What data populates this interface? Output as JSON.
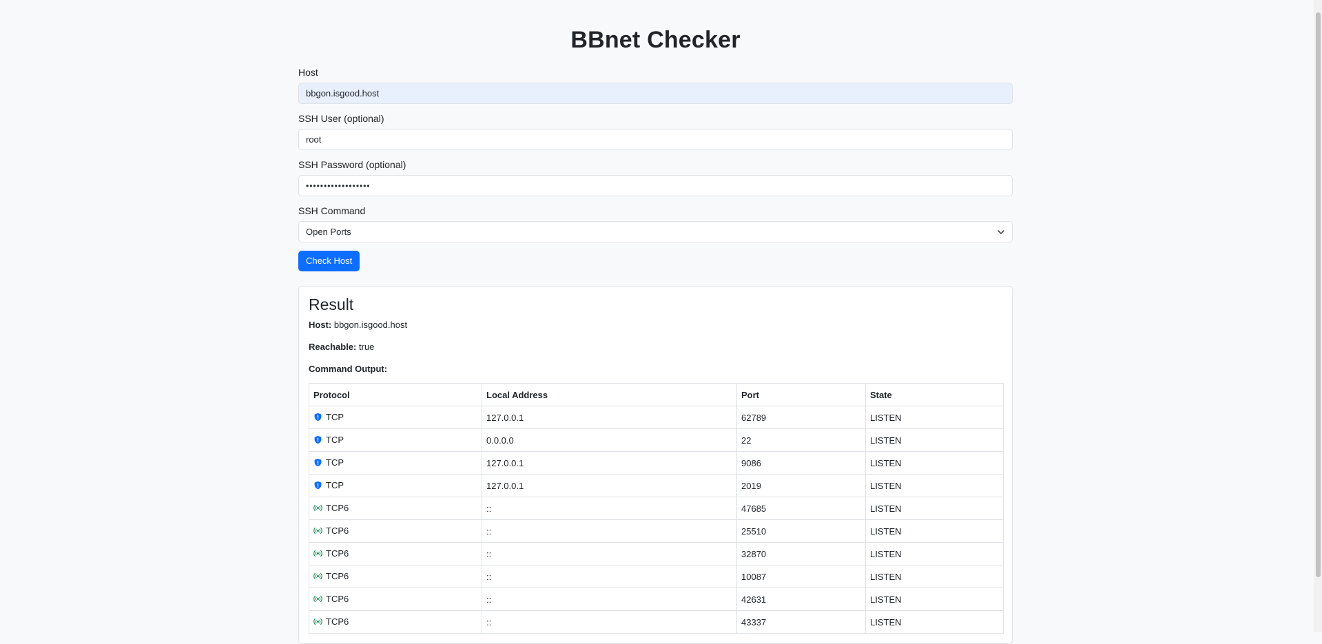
{
  "page": {
    "title": "BBnet Checker"
  },
  "form": {
    "host_label": "Host",
    "host_value": "bbgon.isgood.host",
    "ssh_user_label": "SSH User (optional)",
    "ssh_user_value": "root",
    "ssh_password_label": "SSH Password (optional)",
    "ssh_password_value": "••••••••••••••••••",
    "ssh_command_label": "SSH Command",
    "ssh_command_selected": "Open Ports",
    "submit_label": "Check Host"
  },
  "result": {
    "title": "Result",
    "host_label": "Host:",
    "host_value": "bbgon.isgood.host",
    "reachable_label": "Reachable:",
    "reachable_value": "true",
    "command_output_label": "Command Output:",
    "table": {
      "headers": [
        "Protocol",
        "Local Address",
        "Port",
        "State"
      ],
      "rows": [
        {
          "icon": "shield-icon",
          "protocol": "TCP",
          "address": "127.0.0.1",
          "port": "62789",
          "state": "LISTEN"
        },
        {
          "icon": "shield-icon",
          "protocol": "TCP",
          "address": "0.0.0.0",
          "port": "22",
          "state": "LISTEN"
        },
        {
          "icon": "shield-icon",
          "protocol": "TCP",
          "address": "127.0.0.1",
          "port": "9086",
          "state": "LISTEN"
        },
        {
          "icon": "shield-icon",
          "protocol": "TCP",
          "address": "127.0.0.1",
          "port": "2019",
          "state": "LISTEN"
        },
        {
          "icon": "broadcast-icon",
          "protocol": "TCP6",
          "address": "::",
          "port": "47685",
          "state": "LISTEN"
        },
        {
          "icon": "broadcast-icon",
          "protocol": "TCP6",
          "address": "::",
          "port": "25510",
          "state": "LISTEN"
        },
        {
          "icon": "broadcast-icon",
          "protocol": "TCP6",
          "address": "::",
          "port": "32870",
          "state": "LISTEN"
        },
        {
          "icon": "broadcast-icon",
          "protocol": "TCP6",
          "address": "::",
          "port": "10087",
          "state": "LISTEN"
        },
        {
          "icon": "broadcast-icon",
          "protocol": "TCP6",
          "address": "::",
          "port": "42631",
          "state": "LISTEN"
        },
        {
          "icon": "broadcast-icon",
          "protocol": "TCP6",
          "address": "::",
          "port": "43337",
          "state": "LISTEN"
        }
      ]
    }
  },
  "colors": {
    "primary": "#0d6efd",
    "tcp_icon": "#0d6efd",
    "tcp6_icon": "#198754",
    "background": "#f8f9fa"
  }
}
